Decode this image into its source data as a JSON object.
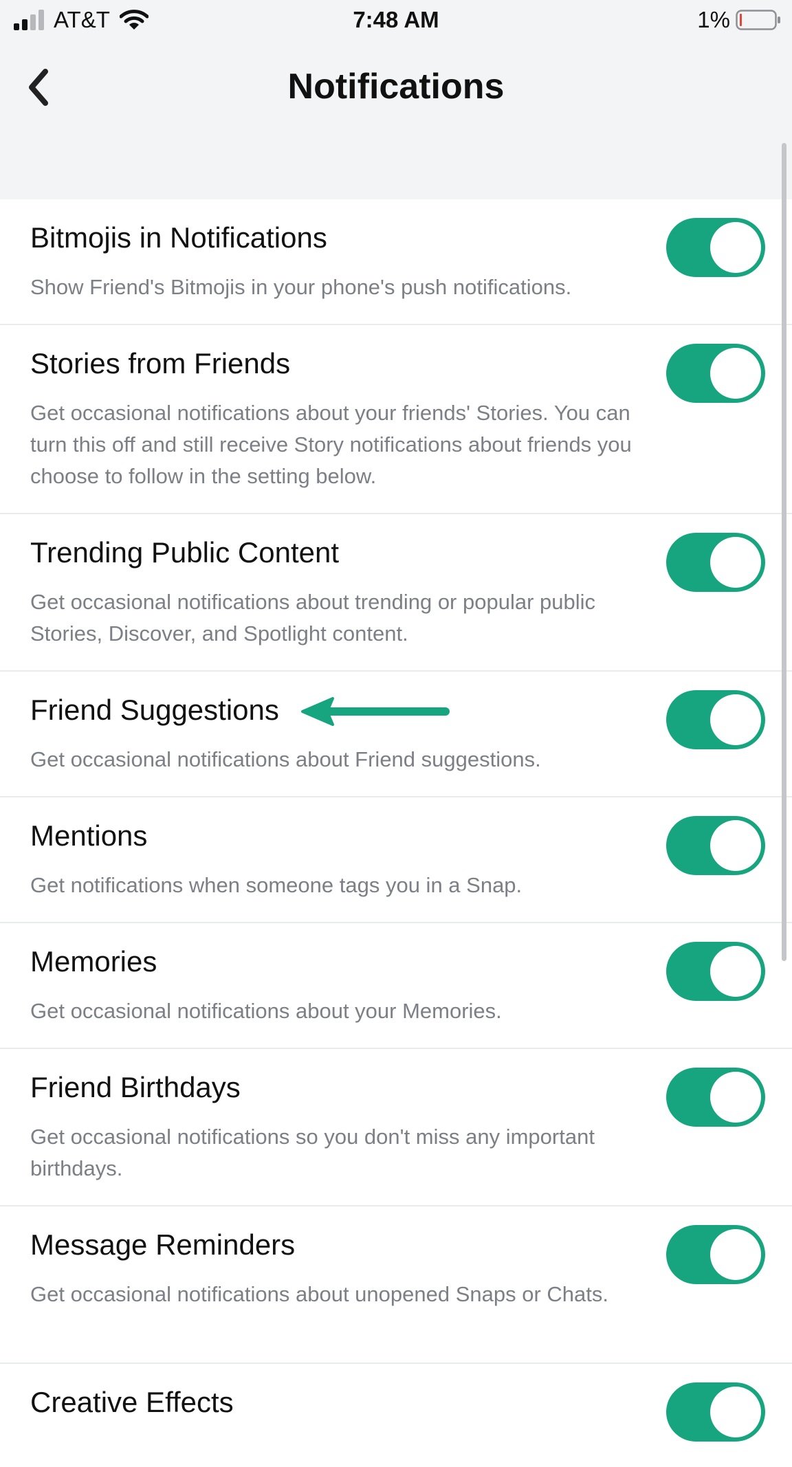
{
  "status_bar": {
    "carrier": "AT&T",
    "time": "7:48 AM",
    "battery_percent": "1%",
    "battery_level": 0.01,
    "signal_icon": "cellular-signal-icon",
    "wifi_icon": "wifi-icon",
    "battery_icon": "battery-low-icon"
  },
  "header": {
    "title": "Notifications",
    "back_icon": "chevron-left-icon"
  },
  "colors": {
    "accent": "#17A57F",
    "background": "#F3F4F6",
    "text": "#111111",
    "secondary_text": "#7C7F86",
    "battery_low": "#E0463A"
  },
  "settings": [
    {
      "title": "Bitmojis in Notifications",
      "description": "Show Friend's Bitmojis in your phone's push notifications.",
      "enabled": true
    },
    {
      "title": "Stories from Friends",
      "description": "Get occasional notifications about your friends' Stories. You can turn this off and still receive Story notifications about friends you choose to follow in the setting below.",
      "enabled": true
    },
    {
      "title": "Trending Public Content",
      "description": "Get occasional notifications about trending or popular public Stories, Discover, and Spotlight content.",
      "enabled": true
    },
    {
      "title": "Friend Suggestions",
      "description": "Get occasional notifications about Friend suggestions.",
      "enabled": true
    },
    {
      "title": "Mentions",
      "description": "Get notifications when someone tags you in a Snap.",
      "enabled": true
    },
    {
      "title": "Memories",
      "description": "Get occasional notifications about your Memories.",
      "enabled": true
    },
    {
      "title": "Friend Birthdays",
      "description": "Get occasional notifications so you don't miss any important birthdays.",
      "enabled": true
    },
    {
      "title": "Message Reminders",
      "description": "Get occasional notifications about unopened Snaps or Chats.",
      "enabled": true
    },
    {
      "title": "Creative Effects",
      "description": "",
      "enabled": true
    }
  ],
  "annotation": {
    "icon": "arrow-left-icon",
    "points_to": "Friend Suggestions"
  }
}
